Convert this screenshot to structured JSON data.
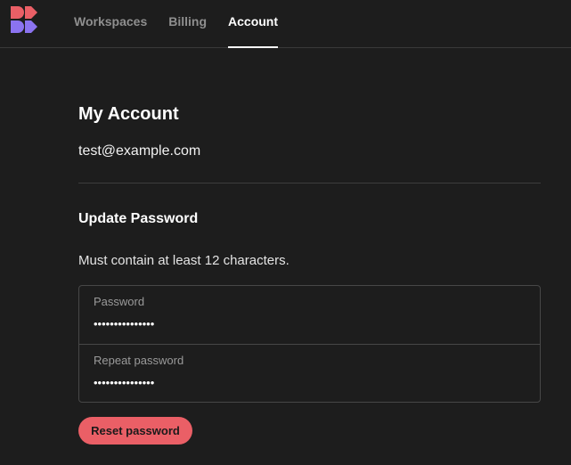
{
  "header": {
    "logo": {
      "icon": "app-logo-icon",
      "colors": {
        "top": "#ea5f66",
        "bottom": "#8b73f0"
      }
    },
    "nav": [
      {
        "label": "Workspaces",
        "active": false
      },
      {
        "label": "Billing",
        "active": false
      },
      {
        "label": "Account",
        "active": true
      }
    ]
  },
  "account": {
    "title": "My Account",
    "email": "test@example.com"
  },
  "password": {
    "title": "Update Password",
    "hint": "Must contain at least 12 characters.",
    "password_label": "Password",
    "password_value": "•••••••••••••••",
    "repeat_label": "Repeat password",
    "repeat_value": "•••••••••••••••",
    "reset_label": "Reset password"
  },
  "colors": {
    "background": "#1d1d1d",
    "accent": "#ea5f66",
    "secondary_accent": "#8b73f0",
    "muted_text": "#8f8f8f"
  }
}
